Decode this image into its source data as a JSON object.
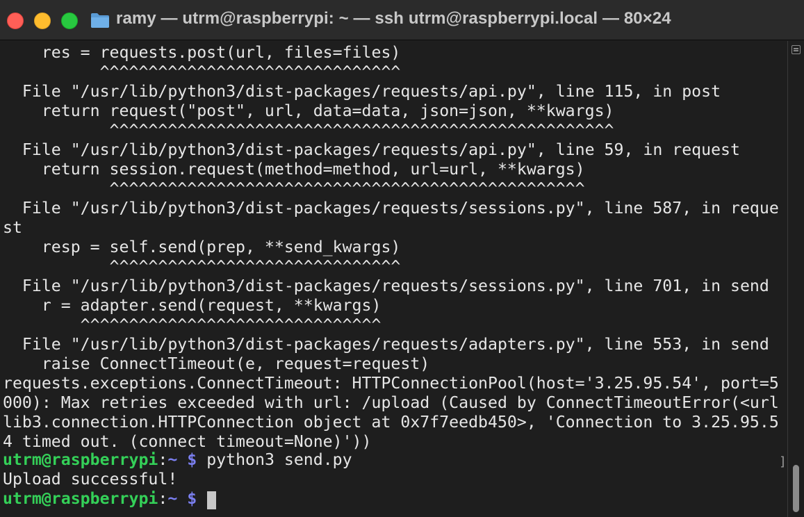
{
  "window": {
    "title": "ramy — utrm@raspberrypi: ~ — ssh utrm@raspberrypi.local — 80×24"
  },
  "colors": {
    "background": "#1e1e1e",
    "text": "#e6e6e6",
    "prompt_user": "#34d058",
    "prompt_path": "#7b7ff0"
  },
  "icons": {
    "folder": "folder-icon",
    "close": "close-icon",
    "minimize": "minimize-icon",
    "maximize": "maximize-icon",
    "scroll_marker": "marks-icon"
  },
  "terminal": {
    "lines": [
      "    res = requests.post(url, files=files)",
      "          ^^^^^^^^^^^^^^^^^^^^^^^^^^^^^^^",
      "  File \"/usr/lib/python3/dist-packages/requests/api.py\", line 115, in post",
      "    return request(\"post\", url, data=data, json=json, **kwargs)",
      "           ^^^^^^^^^^^^^^^^^^^^^^^^^^^^^^^^^^^^^^^^^^^^^^^^^^^^",
      "  File \"/usr/lib/python3/dist-packages/requests/api.py\", line 59, in request",
      "    return session.request(method=method, url=url, **kwargs)",
      "           ^^^^^^^^^^^^^^^^^^^^^^^^^^^^^^^^^^^^^^^^^^^^^^^^^",
      "  File \"/usr/lib/python3/dist-packages/requests/sessions.py\", line 587, in reque",
      "st",
      "    resp = self.send(prep, **send_kwargs)",
      "           ^^^^^^^^^^^^^^^^^^^^^^^^^^^^^^",
      "  File \"/usr/lib/python3/dist-packages/requests/sessions.py\", line 701, in send",
      "    r = adapter.send(request, **kwargs)",
      "        ^^^^^^^^^^^^^^^^^^^^^^^^^^^^^^^",
      "  File \"/usr/lib/python3/dist-packages/requests/adapters.py\", line 553, in send",
      "    raise ConnectTimeout(e, request=request)",
      "requests.exceptions.ConnectTimeout: HTTPConnectionPool(host='3.25.95.54', port=5",
      "000): Max retries exceeded with url: /upload (Caused by ConnectTimeoutError(<url",
      "lib3.connection.HTTPConnection object at 0x7f7eedb450>, 'Connection to 3.25.95.5",
      "4 timed out. (connect timeout=None)'))"
    ],
    "prompt1": {
      "user_host": "utrm@raspberrypi",
      "sep": ":",
      "path": "~",
      "dollar": " $",
      "command": " python3 send.py"
    },
    "output": "Upload successful!",
    "prompt2": {
      "user_host": "utrm@raspberrypi",
      "sep": ":",
      "path": "~",
      "dollar": " $"
    },
    "bracket": "]"
  }
}
